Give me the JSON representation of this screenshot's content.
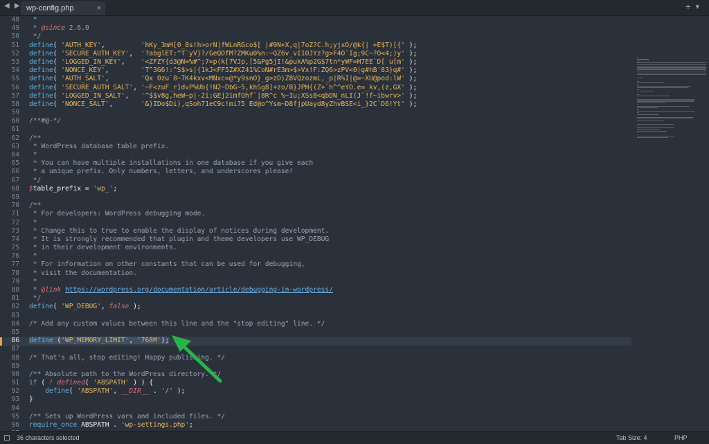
{
  "tab": {
    "title": "wp-config.php",
    "close": "×"
  },
  "tabbar": {
    "back_forward": "◀ ▶",
    "add": "+",
    "menu": "▾"
  },
  "editor": {
    "current_line": 86,
    "lines": [
      {
        "n": "48",
        "tokens": [
          {
            "c": "c",
            "t": " *"
          }
        ]
      },
      {
        "n": "49",
        "tokens": [
          {
            "c": "c",
            "t": " * "
          },
          {
            "c": "k",
            "t": "@since"
          },
          {
            "c": "c",
            "t": " 2.6.0"
          }
        ]
      },
      {
        "n": "50",
        "tokens": [
          {
            "c": "c",
            "t": " */"
          }
        ]
      },
      {
        "n": "51",
        "tokens": [
          {
            "c": "f",
            "t": "define"
          },
          {
            "c": "t",
            "t": "( "
          },
          {
            "c": "s",
            "t": "'AUTH_KEY'"
          },
          {
            "c": "t",
            "t": ",         "
          },
          {
            "c": "s",
            "t": "'hKy_3mH[0_8s!h>orN|fWLnRGco$[ |#9N+X,q|7oZ?C.h;yjxO/@k{| +E$T)[{'"
          },
          {
            "c": "t",
            "t": " );"
          }
        ]
      },
      {
        "n": "52",
        "tokens": [
          {
            "c": "f",
            "t": "define"
          },
          {
            "c": "t",
            "t": "( "
          },
          {
            "c": "s",
            "t": "'SECURE_AUTH_KEY'"
          },
          {
            "c": "t",
            "t": ",  "
          },
          {
            "c": "s",
            "t": "'?abglET:^T`yV}?/GeQDfM?ZMKu0%n:~QZ6v_vI1OJYz?g>F4O`Ig;9C~?O<4;)y'"
          },
          {
            "c": "t",
            "t": " );"
          }
        ]
      },
      {
        "n": "53",
        "tokens": [
          {
            "c": "f",
            "t": "define"
          },
          {
            "c": "t",
            "t": "( "
          },
          {
            "c": "s",
            "t": "'LOGGED_IN_KEY'"
          },
          {
            "c": "t",
            "t": ",    "
          },
          {
            "c": "s",
            "t": "'<ZFZY{d3@N=%#^;7=p(k[7VJp,[5&Pg5jI!&pukA%p2G$7tn*yWF=H7EE`D[ u[m'"
          },
          {
            "c": "t",
            "t": " );"
          }
        ]
      },
      {
        "n": "54",
        "tokens": [
          {
            "c": "f",
            "t": "define"
          },
          {
            "c": "t",
            "t": "( "
          },
          {
            "c": "s",
            "t": "'NONCE_KEY'"
          },
          {
            "c": "t",
            "t": ",        "
          },
          {
            "c": "s",
            "t": "'T^3G6!:^S$>s|{1kJ<FF5Z#XZ41%CoN#rE3m>$>Vx!F:ZQ6>zPV<0|g#hB'83}q#'"
          },
          {
            "c": "t",
            "t": " );"
          }
        ]
      },
      {
        "n": "55",
        "tokens": [
          {
            "c": "f",
            "t": "define"
          },
          {
            "c": "t",
            "t": "( "
          },
          {
            "c": "s",
            "t": "'AUTH_SALT'"
          },
          {
            "c": "t",
            "t": ",        "
          },
          {
            "c": "s",
            "t": "'Qx 0zu`8~7K4kxv<MNxc=@*y9snO}_g>zD)Z8VQzozmL,_p|R%I|@=~XU@pod:lW'"
          },
          {
            "c": "t",
            "t": " );"
          }
        ]
      },
      {
        "n": "56",
        "tokens": [
          {
            "c": "f",
            "t": "define"
          },
          {
            "c": "t",
            "t": "( "
          },
          {
            "c": "s",
            "t": "'SECURE_AUTH_SALT'"
          },
          {
            "c": "t",
            "t": ", "
          },
          {
            "c": "s",
            "t": "'~F<zuF_r]dvP%Ub{!N2~DbG~5,khSg8]+zo/B}JPH{(Z+`h^^eYO.e=_kv,(z,GX'"
          },
          {
            "c": "t",
            "t": " );"
          }
        ]
      },
      {
        "n": "57",
        "tokens": [
          {
            "c": "f",
            "t": "define"
          },
          {
            "c": "t",
            "t": "( "
          },
          {
            "c": "s",
            "t": "'LOGGED_IN_SALT'"
          },
          {
            "c": "t",
            "t": ",   "
          },
          {
            "c": "s",
            "t": "'^$$v8g,heW~p|-2i;GEj2imfOhf`|8R^c %~Iu;XSsB<qbDN_nLI(J`!f~ibwrv>'"
          },
          {
            "c": "t",
            "t": " );"
          }
        ]
      },
      {
        "n": "58",
        "tokens": [
          {
            "c": "f",
            "t": "define"
          },
          {
            "c": "t",
            "t": "( "
          },
          {
            "c": "s",
            "t": "'NONCE_SALT'"
          },
          {
            "c": "t",
            "t": ",       "
          },
          {
            "c": "s",
            "t": "'&}IDo$Di),qSoh71eC9c!mi?5 Ed@o^Ysm~D8fjpUayd8yZhvBSE<i_}2C`D6!Yt'"
          },
          {
            "c": "t",
            "t": " );"
          }
        ]
      },
      {
        "n": "59",
        "tokens": []
      },
      {
        "n": "60",
        "tokens": [
          {
            "c": "c",
            "t": "/**#@-*/"
          }
        ]
      },
      {
        "n": "61",
        "tokens": []
      },
      {
        "n": "62",
        "tokens": [
          {
            "c": "c",
            "t": "/**"
          }
        ]
      },
      {
        "n": "63",
        "tokens": [
          {
            "c": "c",
            "t": " * WordPress database table prefix."
          }
        ]
      },
      {
        "n": "64",
        "tokens": [
          {
            "c": "c",
            "t": " *"
          }
        ]
      },
      {
        "n": "65",
        "tokens": [
          {
            "c": "c",
            "t": " * You can have multiple installations in one database if you give each"
          }
        ]
      },
      {
        "n": "66",
        "tokens": [
          {
            "c": "c",
            "t": " * a unique prefix. Only numbers, letters, and underscores please!"
          }
        ]
      },
      {
        "n": "67",
        "tokens": [
          {
            "c": "c",
            "t": " */"
          }
        ]
      },
      {
        "n": "68",
        "tokens": [
          {
            "c": "k",
            "t": "$"
          },
          {
            "c": "t",
            "t": "table_prefix = "
          },
          {
            "c": "s",
            "t": "'wp_'"
          },
          {
            "c": "t",
            "t": ";"
          }
        ]
      },
      {
        "n": "69",
        "tokens": []
      },
      {
        "n": "70",
        "tokens": [
          {
            "c": "c",
            "t": "/**"
          }
        ]
      },
      {
        "n": "71",
        "tokens": [
          {
            "c": "c",
            "t": " * For developers: WordPress debugging mode."
          }
        ]
      },
      {
        "n": "72",
        "tokens": [
          {
            "c": "c",
            "t": " *"
          }
        ]
      },
      {
        "n": "73",
        "tokens": [
          {
            "c": "c",
            "t": " * Change this to true to enable the display of notices during development."
          }
        ]
      },
      {
        "n": "74",
        "tokens": [
          {
            "c": "c",
            "t": " * It is strongly recommended that plugin and theme developers use WP_DEBUG"
          }
        ]
      },
      {
        "n": "75",
        "tokens": [
          {
            "c": "c",
            "t": " * in their development environments."
          }
        ]
      },
      {
        "n": "76",
        "tokens": [
          {
            "c": "c",
            "t": " *"
          }
        ]
      },
      {
        "n": "77",
        "tokens": [
          {
            "c": "c",
            "t": " * For information on other constants that can be used for debugging,"
          }
        ]
      },
      {
        "n": "78",
        "tokens": [
          {
            "c": "c",
            "t": " * visit the documentation."
          }
        ]
      },
      {
        "n": "79",
        "tokens": [
          {
            "c": "c",
            "t": " *"
          }
        ]
      },
      {
        "n": "80",
        "tokens": [
          {
            "c": "c",
            "t": " * "
          },
          {
            "c": "k",
            "t": "@link"
          },
          {
            "c": "c",
            "t": " "
          },
          {
            "c": "u",
            "t": "https://wordpress.org/documentation/article/debugging-in-wordpress/"
          }
        ]
      },
      {
        "n": "81",
        "tokens": [
          {
            "c": "c",
            "t": " */"
          }
        ]
      },
      {
        "n": "82",
        "tokens": [
          {
            "c": "f",
            "t": "define"
          },
          {
            "c": "t",
            "t": "( "
          },
          {
            "c": "s",
            "t": "'WP_DEBUG'"
          },
          {
            "c": "t",
            "t": ", "
          },
          {
            "c": "k",
            "t": "false"
          },
          {
            "c": "t",
            "t": " );"
          }
        ]
      },
      {
        "n": "83",
        "tokens": []
      },
      {
        "n": "84",
        "tokens": [
          {
            "c": "c",
            "t": "/* Add any custom values between this line and the \"stop editing\" line. */"
          }
        ]
      },
      {
        "n": "85",
        "tokens": []
      },
      {
        "n": "86",
        "tokens": [
          {
            "c": "f",
            "t": "define"
          },
          {
            "c": "t",
            "t": " ("
          },
          {
            "c": "s",
            "t": "'WP_MEMORY_LIMIT'"
          },
          {
            "c": "t",
            "t": ", "
          },
          {
            "c": "s",
            "t": "'768M'"
          },
          {
            "c": "t",
            "t": ");"
          }
        ],
        "selected": true
      },
      {
        "n": "87",
        "tokens": []
      },
      {
        "n": "88",
        "tokens": [
          {
            "c": "c",
            "t": "/* That's all, stop editing! Happy publishing. */"
          }
        ]
      },
      {
        "n": "89",
        "tokens": []
      },
      {
        "n": "90",
        "tokens": [
          {
            "c": "c",
            "t": "/** Absolute path to the WordPress directory. */"
          }
        ]
      },
      {
        "n": "91",
        "tokens": [
          {
            "c": "f",
            "t": "if"
          },
          {
            "c": "t",
            "t": " ( "
          },
          {
            "c": "k",
            "t": "!"
          },
          {
            "c": "t",
            "t": " "
          },
          {
            "c": "k",
            "t": "defined"
          },
          {
            "c": "t",
            "t": "( "
          },
          {
            "c": "s",
            "t": "'ABSPATH'"
          },
          {
            "c": "t",
            "t": " ) ) {"
          }
        ]
      },
      {
        "n": "92",
        "tokens": [
          {
            "c": "t",
            "t": "    "
          },
          {
            "c": "f",
            "t": "define"
          },
          {
            "c": "t",
            "t": "( "
          },
          {
            "c": "s",
            "t": "'ABSPATH'"
          },
          {
            "c": "t",
            "t": ", "
          },
          {
            "c": "k",
            "t": "__DIR__"
          },
          {
            "c": "t",
            "t": " . "
          },
          {
            "c": "s",
            "t": "'/'"
          },
          {
            "c": "t",
            "t": " );"
          }
        ]
      },
      {
        "n": "93",
        "tokens": [
          {
            "c": "t",
            "t": "}"
          }
        ]
      },
      {
        "n": "94",
        "tokens": []
      },
      {
        "n": "95",
        "tokens": [
          {
            "c": "c",
            "t": "/** Sets up WordPress vars and included files. */"
          }
        ]
      },
      {
        "n": "96",
        "tokens": [
          {
            "c": "f",
            "t": "require_once"
          },
          {
            "c": "t",
            "t": " ABSPATH . "
          },
          {
            "c": "s",
            "t": "'wp-settings.php'"
          },
          {
            "c": "t",
            "t": ";"
          }
        ]
      },
      {
        "n": "97",
        "tokens": []
      }
    ]
  },
  "statusbar": {
    "selection": "36 characters selected",
    "tab_size": "Tab Size: 4",
    "syntax": "PHP"
  },
  "colors": {
    "background": "#2b313a",
    "string": "#e8b65f",
    "function": "#5fb3e0",
    "keyword": "#e06c75",
    "comment": "#9aa5b1",
    "annotation_arrow": "#2bb24c"
  }
}
